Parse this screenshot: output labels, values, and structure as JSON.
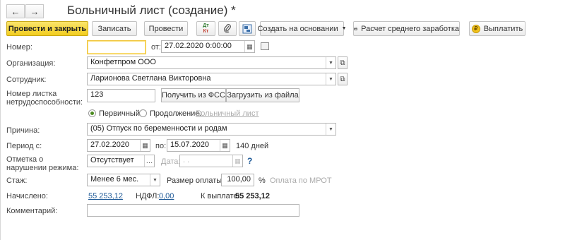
{
  "window": {
    "title": "Больничный лист (создание) *"
  },
  "nav": {
    "back_icon": "←",
    "forward_icon": "→"
  },
  "toolbar": {
    "post_close": "Провести и закрыть",
    "save": "Записать",
    "post": "Провести",
    "dtkt_icon_top": "Дт",
    "dtkt_icon_bottom": "Кт",
    "create_based": "Создать на основании",
    "avg_earnings": "Расчет среднего заработка",
    "pay": "Выплатить"
  },
  "form": {
    "number_label": "Номер:",
    "number_value": "",
    "from_label": "от:",
    "date_value": "27.02.2020  0:00:00",
    "org_label": "Организация:",
    "org_value": "Конфетпром ООО",
    "employee_label": "Сотрудник:",
    "employee_value": "Ларионова Светлана Викторовна",
    "sheet_number_label": "Номер листка нетрудоспособности:",
    "sheet_number_value": "123",
    "get_fss": "Получить из ФСС",
    "load_file": "Загрузить из файла",
    "primary_label": "Первичный",
    "continuation_label": "Продолжение:",
    "continuation_link": "Больничный лист",
    "reason_label": "Причина:",
    "reason_value": "(05) Отпуск по беременности и родам",
    "period_label": "Период с:",
    "period_from": "27.02.2020",
    "period_to_label": "по:",
    "period_to": "15.07.2020",
    "period_days": "140 дней",
    "violation_label": "Отметка о нарушении режима:",
    "violation_value": "Отсутствует",
    "violation_date_label": "Дата:",
    "violation_date_value": " .  .",
    "help_mark": "?",
    "seniority_label": "Стаж:",
    "seniority_value": "Менее 6 мес.",
    "pay_size_label": "Размер оплаты:",
    "pay_size_value": "100,00",
    "percent": "%",
    "mrot_label": "Оплата по МРОТ",
    "accrued_label": "Начислено:",
    "accrued_value": "55 253,12",
    "ndfl_label": "НДФЛ:",
    "ndfl_value": "0,00",
    "topay_label": "К выплате:",
    "topay_value": "55 253,12",
    "comment_label": "Комментарий:",
    "comment_value": ""
  },
  "colors": {
    "primary_button": "#f2cd1f",
    "link": "#1c5896",
    "focus_border": "#f0c43b"
  }
}
